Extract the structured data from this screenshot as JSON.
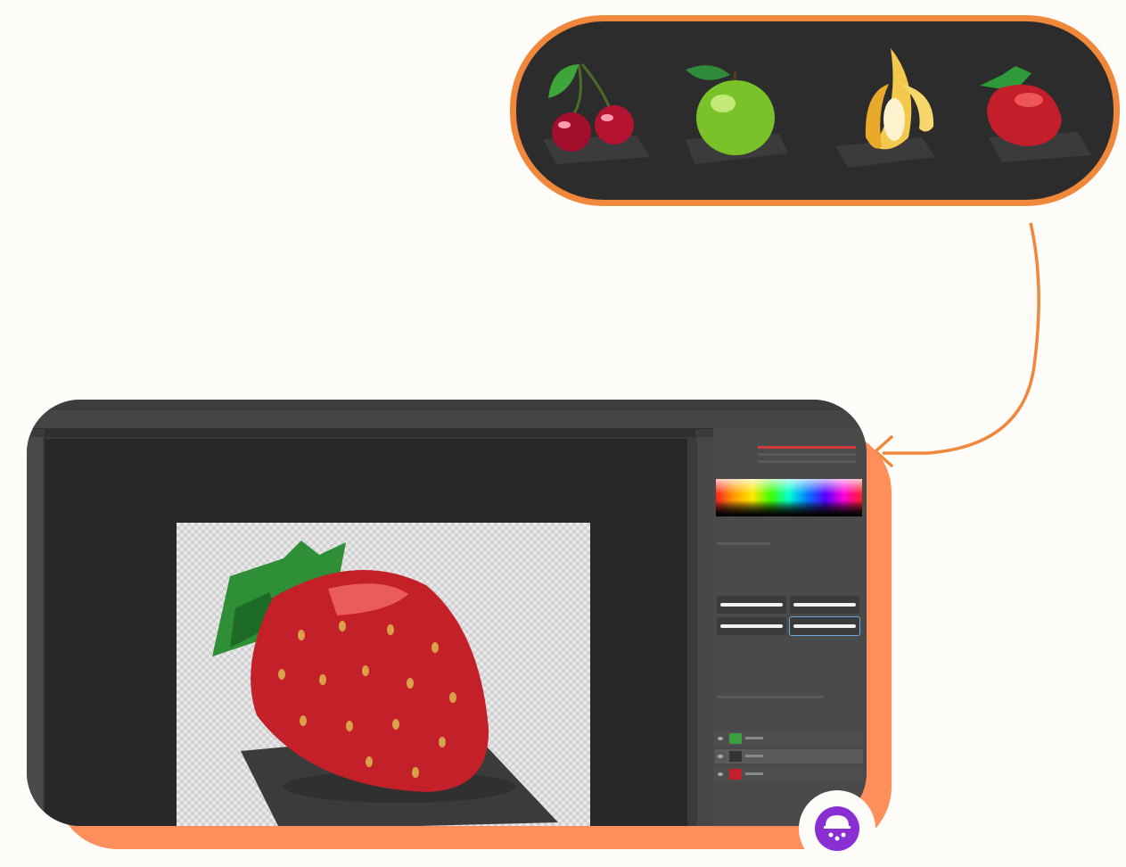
{
  "images": {
    "fruit_strip": [
      "cherry-icon",
      "green-apple-icon",
      "banana-icon",
      "strawberry-icon"
    ],
    "editor_canvas": "strawberry-artwork",
    "brand_logo": "purple-planet-logo"
  },
  "colors": {
    "page_background": "#fdfcf9",
    "accent_orange": "#f0883c",
    "card_shadow": "#ff8f5a",
    "strip_background": "#2c2c2c",
    "editor_background": "#282828",
    "brand_purple": "#8a2fd2"
  }
}
